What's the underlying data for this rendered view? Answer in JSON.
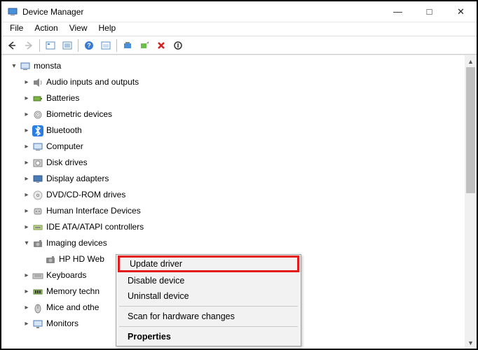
{
  "window": {
    "title": "Device Manager"
  },
  "menubar": [
    "File",
    "Action",
    "View",
    "Help"
  ],
  "tree": {
    "root": "monsta",
    "nodes": [
      {
        "label": "Audio inputs and outputs",
        "expanded": false,
        "icon": "audio"
      },
      {
        "label": "Batteries",
        "expanded": false,
        "icon": "battery"
      },
      {
        "label": "Biometric devices",
        "expanded": false,
        "icon": "biometric"
      },
      {
        "label": "Bluetooth",
        "expanded": false,
        "icon": "bluetooth"
      },
      {
        "label": "Computer",
        "expanded": false,
        "icon": "computer"
      },
      {
        "label": "Disk drives",
        "expanded": false,
        "icon": "disk"
      },
      {
        "label": "Display adapters",
        "expanded": false,
        "icon": "display"
      },
      {
        "label": "DVD/CD-ROM drives",
        "expanded": false,
        "icon": "dvd"
      },
      {
        "label": "Human Interface Devices",
        "expanded": false,
        "icon": "hid"
      },
      {
        "label": "IDE ATA/ATAPI controllers",
        "expanded": false,
        "icon": "ide"
      },
      {
        "label": "Imaging devices",
        "expanded": true,
        "icon": "imaging",
        "children": [
          {
            "label": "HP HD Web",
            "icon": "camera"
          }
        ]
      },
      {
        "label": "Keyboards",
        "expanded": false,
        "icon": "keyboard"
      },
      {
        "label": "Memory techn",
        "expanded": false,
        "icon": "memory"
      },
      {
        "label": "Mice and othe",
        "expanded": false,
        "icon": "mouse"
      },
      {
        "label": "Monitors",
        "expanded": false,
        "icon": "monitor"
      }
    ]
  },
  "context_menu": {
    "items": [
      {
        "label": "Update driver",
        "highlight": true
      },
      {
        "label": "Disable device"
      },
      {
        "label": "Uninstall device"
      },
      {
        "sep": true
      },
      {
        "label": "Scan for hardware changes"
      },
      {
        "sep": true
      },
      {
        "label": "Properties",
        "bold": true
      }
    ]
  }
}
